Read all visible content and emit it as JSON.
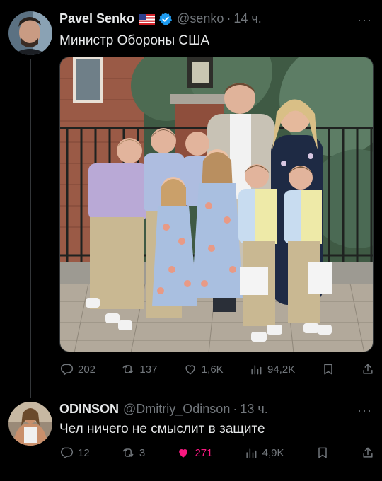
{
  "tweet1": {
    "author_name": "Pavel Senko",
    "handle": "@senko",
    "separator": "·",
    "time": "14 ч.",
    "more": "···",
    "text": "Министр Обороны США",
    "actions": {
      "replies": "202",
      "reposts": "137",
      "likes": "1,6K",
      "views": "94,2K"
    },
    "icons": [
      "flag-us-icon",
      "verified-badge-icon",
      "reply-icon",
      "repost-icon",
      "like-icon",
      "views-icon",
      "bookmark-icon",
      "share-icon"
    ]
  },
  "tweet2": {
    "author_name": "ODINSON",
    "handle": "@Dmitriy_Odinson",
    "separator": "·",
    "time": "13 ч.",
    "more": "···",
    "text": "Чел ничего не смыслит в защите",
    "actions": {
      "replies": "12",
      "reposts": "3",
      "likes": "271",
      "views": "4,9K"
    },
    "liked": true
  },
  "colors": {
    "background": "#000000",
    "text": "#e7e9ea",
    "muted": "#71767b",
    "verified": "#1d9bf0",
    "like_active": "#f91880"
  }
}
